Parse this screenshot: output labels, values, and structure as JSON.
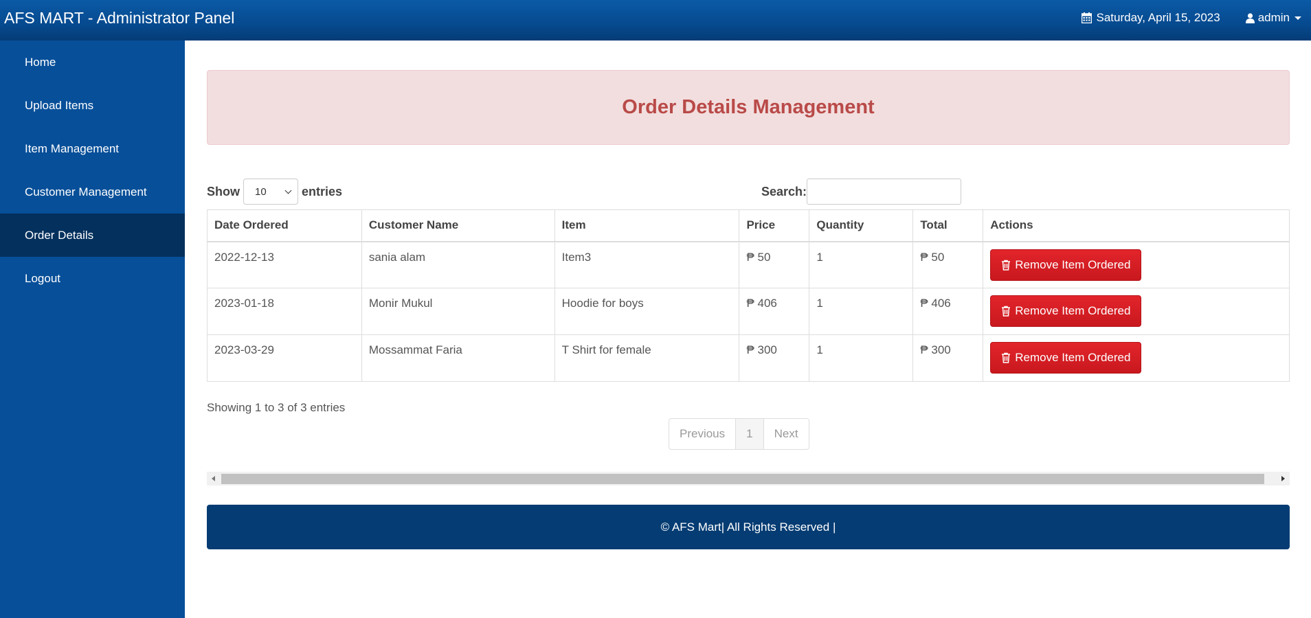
{
  "app": {
    "title": "AFS MART - Administrator Panel"
  },
  "header": {
    "date": "Saturday, April 15, 2023",
    "user": "admin",
    "date_icon": "calendar-icon",
    "user_icon": "user-icon"
  },
  "sidebar": {
    "items": [
      {
        "label": "Home"
      },
      {
        "label": "Upload Items"
      },
      {
        "label": "Item Management"
      },
      {
        "label": "Customer Management"
      },
      {
        "label": "Order Details",
        "active": true
      },
      {
        "label": "Logout"
      }
    ]
  },
  "main": {
    "banner_title": "Order Details Management"
  },
  "controls": {
    "show_label": "Show",
    "entries_value": "10",
    "entries_label": "entries",
    "search_label": "Search:",
    "search_value": ""
  },
  "table": {
    "headers": [
      "Date Ordered",
      "Customer Name",
      "Item",
      "Price",
      "Quantity",
      "Total",
      "Actions"
    ],
    "rows": [
      {
        "date": "2022-12-13",
        "customer": "sania alam",
        "item": "Item3",
        "price": "₱ 50",
        "quantity": "1",
        "total": "₱ 50",
        "action": "Remove Item Ordered"
      },
      {
        "date": "2023-01-18",
        "customer": "Monir Mukul",
        "item": "Hoodie for boys",
        "price": "₱ 406",
        "quantity": "1",
        "total": "₱ 406",
        "action": "Remove Item Ordered"
      },
      {
        "date": "2023-03-29",
        "customer": "Mossammat Faria",
        "item": "T Shirt for female",
        "price": "₱ 300",
        "quantity": "1",
        "total": "₱ 300",
        "action": "Remove Item Ordered"
      }
    ],
    "action_icon": "trash-icon"
  },
  "footer_info": {
    "showing": "Showing 1 to 3 of 3 entries"
  },
  "pagination": {
    "previous": "Previous",
    "current": "1",
    "next": "Next"
  },
  "footer": {
    "text": "© AFS Mart| All Rights Reserved |"
  },
  "colors": {
    "navbar": "#0b5aa6",
    "sidebar": "#074f99",
    "sidebar_active": "#04305d",
    "banner_bg": "#f2dede",
    "banner_text": "#b94a48",
    "danger": "#d9201f",
    "footer": "#053c73"
  }
}
